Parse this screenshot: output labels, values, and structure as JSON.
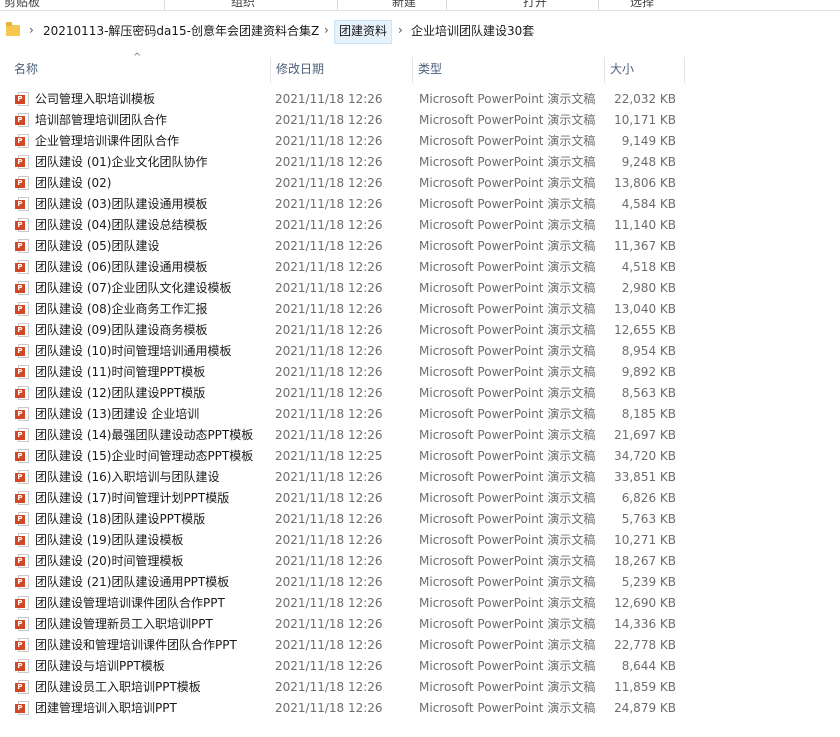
{
  "ribbon": {
    "groups": [
      "剪贴板",
      "组织",
      "新建",
      "打开",
      "选择"
    ]
  },
  "address": {
    "crumbs": [
      "20210113-解压密码da15-创意年会团建资料合集Z",
      "团建资料",
      "企业培训团队建设30套"
    ],
    "separator": "›"
  },
  "columns": {
    "name": "名称",
    "date": "修改日期",
    "type": "类型",
    "size": "大小"
  },
  "files": [
    {
      "name": "公司管理入职培训模板",
      "date": "2021/11/18 12:26",
      "type": "Microsoft PowerPoint 演示文稿",
      "size": "22,032 KB"
    },
    {
      "name": "培训部管理培训团队合作",
      "date": "2021/11/18 12:26",
      "type": "Microsoft PowerPoint 演示文稿",
      "size": "10,171 KB"
    },
    {
      "name": "企业管理培训课件团队合作",
      "date": "2021/11/18 12:26",
      "type": "Microsoft PowerPoint 演示文稿",
      "size": "9,149 KB"
    },
    {
      "name": "团队建设 (01)企业文化团队协作",
      "date": "2021/11/18 12:26",
      "type": "Microsoft PowerPoint 演示文稿",
      "size": "9,248 KB"
    },
    {
      "name": "团队建设 (02)",
      "date": "2021/11/18 12:26",
      "type": "Microsoft PowerPoint 演示文稿",
      "size": "13,806 KB"
    },
    {
      "name": "团队建设 (03)团队建设通用模板",
      "date": "2021/11/18 12:26",
      "type": "Microsoft PowerPoint 演示文稿",
      "size": "4,584 KB"
    },
    {
      "name": "团队建设 (04)团队建设总结模板",
      "date": "2021/11/18 12:26",
      "type": "Microsoft PowerPoint 演示文稿",
      "size": "11,140 KB"
    },
    {
      "name": "团队建设 (05)团队建设",
      "date": "2021/11/18 12:26",
      "type": "Microsoft PowerPoint 演示文稿",
      "size": "11,367 KB"
    },
    {
      "name": "团队建设 (06)团队建设通用模板",
      "date": "2021/11/18 12:26",
      "type": "Microsoft PowerPoint 演示文稿",
      "size": "4,518 KB"
    },
    {
      "name": "团队建设 (07)企业团队文化建设模板",
      "date": "2021/11/18 12:26",
      "type": "Microsoft PowerPoint 演示文稿",
      "size": "2,980 KB"
    },
    {
      "name": "团队建设 (08)企业商务工作汇报",
      "date": "2021/11/18 12:26",
      "type": "Microsoft PowerPoint 演示文稿",
      "size": "13,040 KB"
    },
    {
      "name": "团队建设 (09)团队建设商务模板",
      "date": "2021/11/18 12:26",
      "type": "Microsoft PowerPoint 演示文稿",
      "size": "12,655 KB"
    },
    {
      "name": "团队建设 (10)时间管理培训通用模板",
      "date": "2021/11/18 12:26",
      "type": "Microsoft PowerPoint 演示文稿",
      "size": "8,954 KB"
    },
    {
      "name": "团队建设 (11)时间管理PPT模板",
      "date": "2021/11/18 12:26",
      "type": "Microsoft PowerPoint 演示文稿",
      "size": "9,892 KB"
    },
    {
      "name": "团队建设 (12)团队建设PPT模版",
      "date": "2021/11/18 12:26",
      "type": "Microsoft PowerPoint 演示文稿",
      "size": "8,563 KB"
    },
    {
      "name": "团队建设 (13)团建设 企业培训",
      "date": "2021/11/18 12:26",
      "type": "Microsoft PowerPoint 演示文稿",
      "size": "8,185 KB"
    },
    {
      "name": "团队建设 (14)最强团队建设动态PPT模板",
      "date": "2021/11/18 12:26",
      "type": "Microsoft PowerPoint 演示文稿",
      "size": "21,697 KB"
    },
    {
      "name": "团队建设 (15)企业时间管理动态PPT模板",
      "date": "2021/11/18 12:25",
      "type": "Microsoft PowerPoint 演示文稿",
      "size": "34,720 KB"
    },
    {
      "name": "团队建设 (16)入职培训与团队建设",
      "date": "2021/11/18 12:26",
      "type": "Microsoft PowerPoint 演示文稿",
      "size": "33,851 KB"
    },
    {
      "name": "团队建设 (17)时间管理计划PPT模版",
      "date": "2021/11/18 12:26",
      "type": "Microsoft PowerPoint 演示文稿",
      "size": "6,826 KB"
    },
    {
      "name": "团队建设 (18)团队建设PPT模版",
      "date": "2021/11/18 12:26",
      "type": "Microsoft PowerPoint 演示文稿",
      "size": "5,763 KB"
    },
    {
      "name": "团队建设 (19)团队建设模板",
      "date": "2021/11/18 12:26",
      "type": "Microsoft PowerPoint 演示文稿",
      "size": "10,271 KB"
    },
    {
      "name": "团队建设 (20)时间管理模板",
      "date": "2021/11/18 12:26",
      "type": "Microsoft PowerPoint 演示文稿",
      "size": "18,267 KB"
    },
    {
      "name": "团队建设 (21)团队建设通用PPT模板",
      "date": "2021/11/18 12:26",
      "type": "Microsoft PowerPoint 演示文稿",
      "size": "5,239 KB"
    },
    {
      "name": "团队建设管理培训课件团队合作PPT",
      "date": "2021/11/18 12:26",
      "type": "Microsoft PowerPoint 演示文稿",
      "size": "12,690 KB"
    },
    {
      "name": "团队建设管理新员工入职培训PPT",
      "date": "2021/11/18 12:26",
      "type": "Microsoft PowerPoint 演示文稿",
      "size": "14,336 KB"
    },
    {
      "name": "团队建设和管理培训课件团队合作PPT",
      "date": "2021/11/18 12:26",
      "type": "Microsoft PowerPoint 演示文稿",
      "size": "22,778 KB"
    },
    {
      "name": "团队建设与培训PPT模板",
      "date": "2021/11/18 12:26",
      "type": "Microsoft PowerPoint 演示文稿",
      "size": "8,644 KB"
    },
    {
      "name": "团队建设员工入职培训PPT模板",
      "date": "2021/11/18 12:26",
      "type": "Microsoft PowerPoint 演示文稿",
      "size": "11,859 KB"
    },
    {
      "name": "团建管理培训入职培训PPT",
      "date": "2021/11/18 12:26",
      "type": "Microsoft PowerPoint 演示文稿",
      "size": "24,879 KB"
    }
  ],
  "icons": {
    "file": "powerpoint-file-icon",
    "folder": "folder-icon",
    "sort": "sort-up-icon"
  },
  "colors": {
    "header_text": "#4c607a",
    "ppt_badge": "#d24726",
    "folder": "#f6c750",
    "active_crumb": "#e5f1fb"
  }
}
